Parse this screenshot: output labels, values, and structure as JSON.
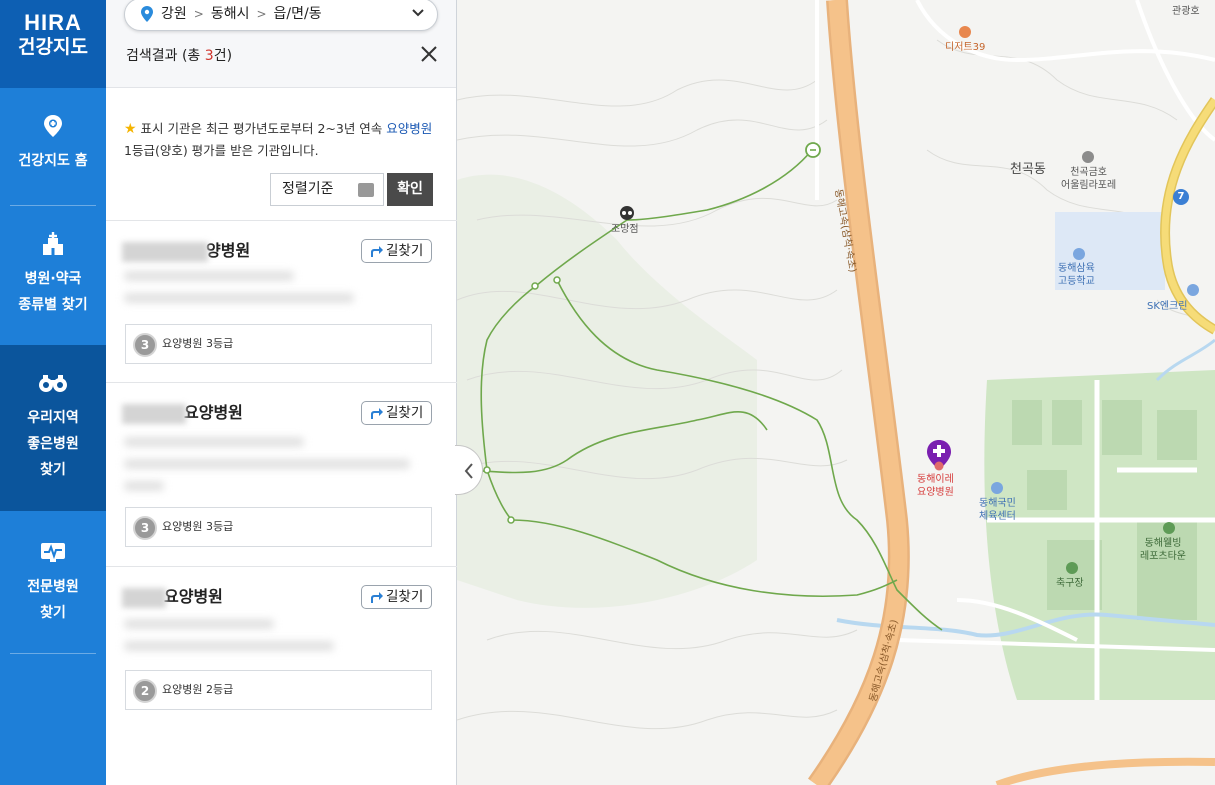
{
  "nav": {
    "logo_line1": "HIRA",
    "logo_line2": "건강지도",
    "items": [
      {
        "id": "home",
        "label": "건강지도 홈"
      },
      {
        "id": "type",
        "label": "병원·약국\n종류별 찾기"
      },
      {
        "id": "good",
        "label": "우리지역\n좋은병원\n찾기"
      },
      {
        "id": "special",
        "label": "전문병원\n찾기"
      }
    ]
  },
  "location": {
    "province": "강원",
    "city": "동해시",
    "district": "읍/면/동",
    "separator": ">"
  },
  "results": {
    "label_prefix": "검색결과 (총 ",
    "count": "3",
    "label_suffix": "건)"
  },
  "notice": {
    "text1": "표시 기관은 최근 평가년도로부터 2~3년 연속 ",
    "highlight": "요양병원",
    "text2": "1등급(양호) 평가를 받은 기관입니다."
  },
  "sort": {
    "label": "정렬기준",
    "confirm": "확인"
  },
  "directions_label": "길찾기",
  "hospitals": [
    {
      "name_visible": "양병원",
      "grade_number": "3",
      "grade_text": "요양병원 3등급"
    },
    {
      "name_visible": "요양병원",
      "grade_number": "3",
      "grade_text": "요양병원 3등급"
    },
    {
      "name_visible": "요양병원",
      "grade_number": "2",
      "grade_text": "요양병원 2등급"
    }
  ],
  "map": {
    "labels": {
      "gwangwang": "관광호",
      "detour": "디저트39",
      "cheongok_dong": "천곡동",
      "apt_line1": "천곡금호",
      "apt_line2": "어울림라포레",
      "school_line1": "동해삼육",
      "school_line2": "고등학교",
      "sk": "SK엔크린",
      "jomangjeom": "조망점",
      "highway_top": "동해고속(삼척·속초)",
      "highway_bottom": "동해고속(삼척·속초)",
      "hosp_line1": "동해이레",
      "hosp_line2": "요양병원",
      "gym_line1": "동해국민",
      "gym_line2": "체육센터",
      "wellbeing_line1": "동해웰빙",
      "wellbeing_line2": "레포츠타운",
      "soccer": "축구장",
      "route_no": "7"
    },
    "colors": {
      "road": "#f5c28a",
      "park": "#cfe6c4",
      "trail": "#6fa84c",
      "water": "#b8d8f0"
    }
  }
}
